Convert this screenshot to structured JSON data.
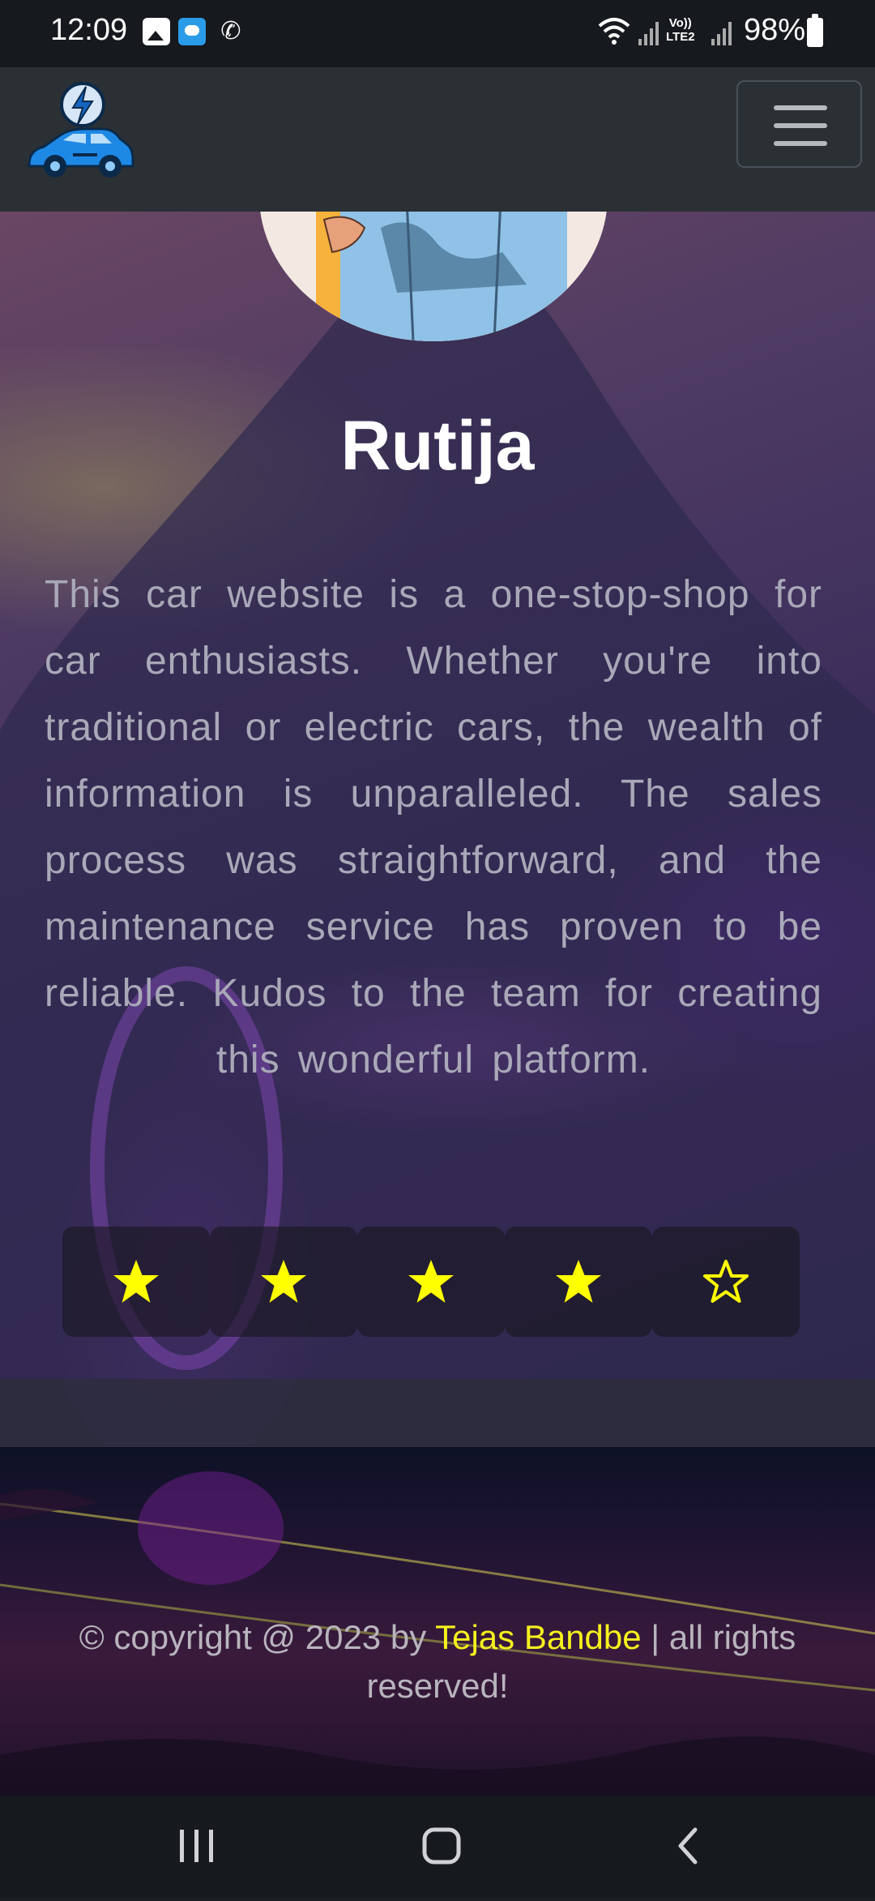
{
  "status_bar": {
    "time": "12:09",
    "network": "Vo)) LTE2",
    "battery": "98%"
  },
  "navbar": {
    "logo_icon": "lightning-car-icon",
    "menu_icon": "hamburger-icon"
  },
  "testimonial": {
    "name": "Rutija",
    "text": "This car website is a one-stop-shop for car enthusiasts. Whether you're into traditional or electric cars, the wealth of information is unparalleled. The sales process was straightforward, and the maintenance service has proven to be reliable. Kudos to the team for creating this wonderful platform.",
    "rating": {
      "value": 4,
      "max": 5,
      "star_color": "#ffff00"
    }
  },
  "footer": {
    "copyright_prefix": "© copyright @ 2023 by ",
    "author": "Tejas Bandbe",
    "copyright_suffix": " | all rights reserved!",
    "accent_color": "#f6f01e"
  },
  "android_nav": {
    "recent_icon": "recent-apps-icon",
    "home_icon": "home-icon",
    "back_icon": "back-icon"
  }
}
